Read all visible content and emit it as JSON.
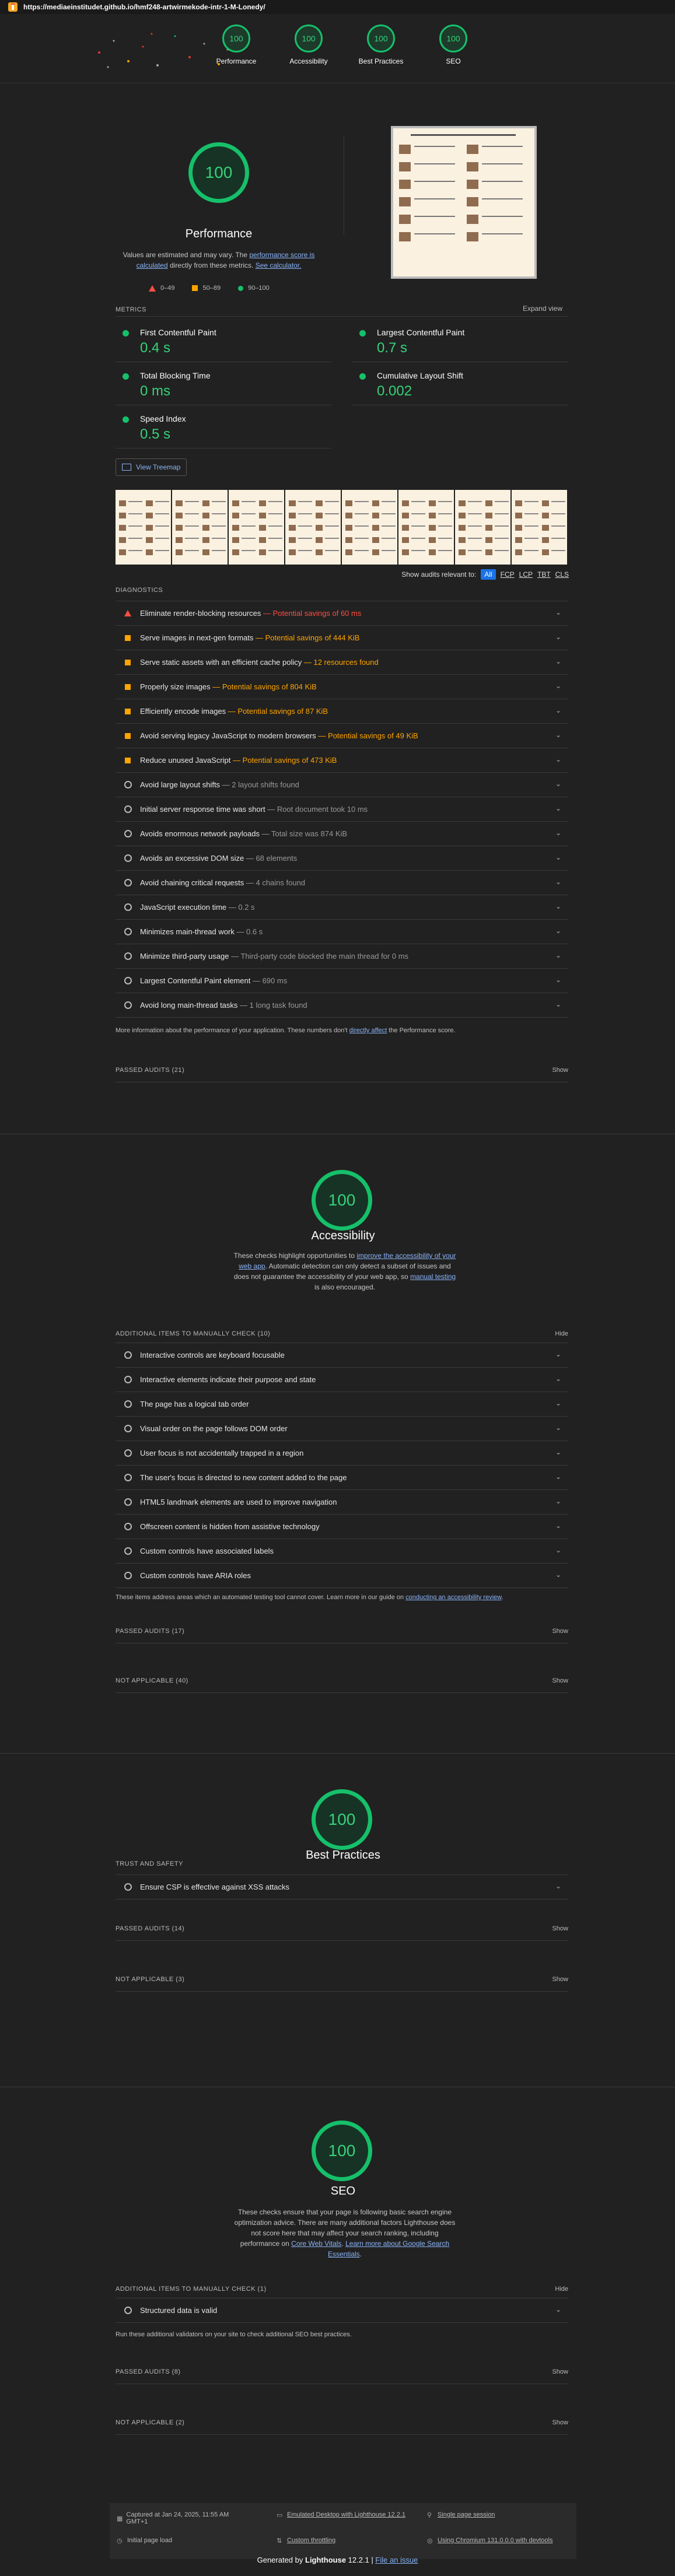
{
  "topbar": {
    "url": "https://mediaeinstitudet.github.io/hmf248-artwirmekode-intr-1-M-Lonedy/"
  },
  "nav": [
    {
      "score": "100",
      "label": "Performance"
    },
    {
      "score": "100",
      "label": "Accessibility"
    },
    {
      "score": "100",
      "label": "Best Practices"
    },
    {
      "score": "100",
      "label": "SEO"
    }
  ],
  "performance": {
    "score": "100",
    "title": "Performance",
    "desc_1": "Values are estimated and may vary. The ",
    "desc_link_1": "performance score is calculated",
    "desc_2": " directly from these metrics. ",
    "desc_link_2": "See calculator.",
    "legend": [
      {
        "label": "0–49"
      },
      {
        "label": "50–89"
      },
      {
        "label": "90–100"
      }
    ],
    "metrics_header": "METRICS",
    "expand_view": "Expand view",
    "metrics": [
      {
        "name": "First Contentful Paint",
        "value": "0.4 s"
      },
      {
        "name": "Largest Contentful Paint",
        "value": "0.7 s"
      },
      {
        "name": "Total Blocking Time",
        "value": "0 ms"
      },
      {
        "name": "Cumulative Layout Shift",
        "value": "0.002"
      },
      {
        "name": "Speed Index",
        "value": "0.5 s"
      }
    ],
    "treemap_button": "View Treemap",
    "show_audits": "Show audits relevant to:",
    "filter_tabs": [
      "All",
      "FCP",
      "LCP",
      "TBT",
      "CLS"
    ],
    "diagnostics_header": "DIAGNOSTICS",
    "audits": [
      {
        "title": "Eliminate render-blocking resources",
        "sub": " — Potential savings of 60 ms",
        "kind": "err"
      },
      {
        "title": "Serve images in next-gen formats",
        "sub": " — Potential savings of 444 KiB",
        "kind": "warn"
      },
      {
        "title": "Serve static assets with an efficient cache policy",
        "sub": " — 12 resources found",
        "kind": "warn"
      },
      {
        "title": "Properly size images",
        "sub": " — Potential savings of 804 KiB",
        "kind": "warn"
      },
      {
        "title": "Efficiently encode images",
        "sub": " — Potential savings of 87 KiB",
        "kind": "warn"
      },
      {
        "title": "Avoid serving legacy JavaScript to modern browsers",
        "sub": " — Potential savings of 49 KiB",
        "kind": "warn"
      },
      {
        "title": "Reduce unused JavaScript",
        "sub": " — Potential savings of 473 KiB",
        "kind": "warn"
      },
      {
        "title": "Avoid large layout shifts",
        "sub": " — 2 layout shifts found",
        "kind": "info"
      },
      {
        "title": "Initial server response time was short",
        "sub": " — Root document took 10 ms",
        "kind": "info"
      },
      {
        "title": "Avoids enormous network payloads",
        "sub": " — Total size was 874 KiB",
        "kind": "info"
      },
      {
        "title": "Avoids an excessive DOM size",
        "sub": " — 68 elements",
        "kind": "info"
      },
      {
        "title": "Avoid chaining critical requests",
        "sub": " — 4 chains found",
        "kind": "info"
      },
      {
        "title": "JavaScript execution time",
        "sub": " — 0.2 s",
        "kind": "info"
      },
      {
        "title": "Minimizes main-thread work",
        "sub": " — 0.6 s",
        "kind": "info"
      },
      {
        "title": "Minimize third-party usage",
        "sub": " — Third-party code blocked the main thread for 0 ms",
        "kind": "info"
      },
      {
        "title": "Largest Contentful Paint element",
        "sub": " — 690 ms",
        "kind": "info"
      },
      {
        "title": "Avoid long main-thread tasks",
        "sub": " — 1 long task found",
        "kind": "info"
      }
    ],
    "more_info_1": "More information about the performance of your application. These numbers don't ",
    "more_info_link": "directly affect",
    "more_info_2": " the Performance score.",
    "passed": "PASSED AUDITS (21)",
    "show": "Show"
  },
  "accessibility": {
    "score": "100",
    "title": "Accessibility",
    "desc_1": "These checks highlight opportunities to ",
    "desc_link_1": "improve the accessibility of your web app",
    "desc_2": ". Automatic detection can only detect a subset of issues and does not guarantee the accessibility of your web app, so ",
    "desc_link_2": "manual testing",
    "desc_3": " is also encouraged.",
    "manual_header": "ADDITIONAL ITEMS TO MANUALLY CHECK (10)",
    "hide": "Hide",
    "items": [
      "Interactive controls are keyboard focusable",
      "Interactive elements indicate their purpose and state",
      "The page has a logical tab order",
      "Visual order on the page follows DOM order",
      "User focus is not accidentally trapped in a region",
      "The user's focus is directed to new content added to the page",
      "HTML5 landmark elements are used to improve navigation",
      "Offscreen content is hidden from assistive technology",
      "Custom controls have associated labels",
      "Custom controls have ARIA roles"
    ],
    "note_1": "These items address areas which an automated testing tool cannot cover. Learn more in our guide on ",
    "note_link": "conducting an accessibility review",
    "note_2": ".",
    "passed": "PASSED AUDITS (17)",
    "not_applicable": "NOT APPLICABLE (40)",
    "show": "Show"
  },
  "best_practices": {
    "score": "100",
    "title": "Best Practices",
    "trust_header": "TRUST AND SAFETY",
    "items": [
      "Ensure CSP is effective against XSS attacks"
    ],
    "passed": "PASSED AUDITS (14)",
    "not_applicable": "NOT APPLICABLE (3)",
    "show": "Show"
  },
  "seo": {
    "score": "100",
    "title": "SEO",
    "desc_1": "These checks ensure that your page is following basic search engine optimization advice. There are many additional factors Lighthouse does not score here that may affect your search ranking, including performance on ",
    "desc_link_1": "Core Web Vitals",
    "desc_2": ". ",
    "desc_link_2": "Learn more about Google Search Essentials",
    "desc_3": ".",
    "manual_header": "ADDITIONAL ITEMS TO MANUALLY CHECK (1)",
    "hide": "Hide",
    "items": [
      "Structured data is valid"
    ],
    "note": "Run these additional validators on your site to check additional SEO best practices.",
    "passed": "PASSED AUDITS (8)",
    "not_applicable": "NOT APPLICABLE (2)",
    "show": "Show"
  },
  "footer": {
    "captured": "Captured at Jan 24, 2025, 11:55 AM GMT+1",
    "initial_load": "Initial page load",
    "emulated": "Emulated Desktop with Lighthouse 12.2.1",
    "throttling": "Custom throttling",
    "session": "Single page session",
    "chromium": "Using Chromium 131.0.0.0 with devtools",
    "generated_by": "Generated by ",
    "lighthouse": "Lighthouse",
    "version": " 12.2.1 | ",
    "file_issue": "File an issue"
  }
}
